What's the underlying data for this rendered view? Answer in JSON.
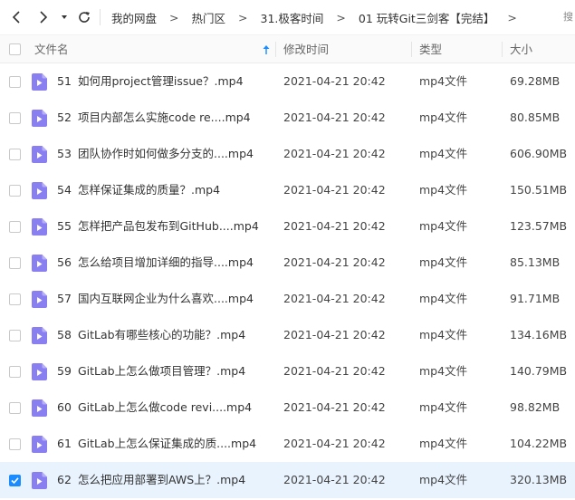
{
  "toolbar": {
    "back_icon": "chevron-left-icon",
    "forward_icon": "chevron-right-icon",
    "history_icon": "caret-down-icon",
    "refresh_icon": "refresh-icon"
  },
  "breadcrumb": {
    "items": [
      "我的网盘",
      "热门区",
      "31.极客时间",
      "01 玩转Git三剑客【完结】"
    ],
    "separator": ">",
    "trailing_chevron": ">"
  },
  "topright_text": "搜",
  "header": {
    "name": "文件名",
    "modified": "修改时间",
    "type": "类型",
    "size": "大小",
    "sort_icon": "sort-ascending-icon"
  },
  "colors": {
    "accent": "#1a8cff",
    "file_icon": "#8a7ff0",
    "selected_row": "#e8f3fe"
  },
  "files": [
    {
      "num": "51",
      "name": "如何用project管理issue？.mp4",
      "modified": "2021-04-21 20:42",
      "type": "mp4文件",
      "size": "69.28MB",
      "checked": false
    },
    {
      "num": "52",
      "name": "项目内部怎么实施code re....mp4",
      "modified": "2021-04-21 20:42",
      "type": "mp4文件",
      "size": "80.85MB",
      "checked": false
    },
    {
      "num": "53",
      "name": "团队协作时如何做多分支的....mp4",
      "modified": "2021-04-21 20:42",
      "type": "mp4文件",
      "size": "606.90MB",
      "checked": false
    },
    {
      "num": "54",
      "name": "怎样保证集成的质量？.mp4",
      "modified": "2021-04-21 20:42",
      "type": "mp4文件",
      "size": "150.51MB",
      "checked": false
    },
    {
      "num": "55",
      "name": "怎样把产品包发布到GitHub....mp4",
      "modified": "2021-04-21 20:42",
      "type": "mp4文件",
      "size": "123.57MB",
      "checked": false
    },
    {
      "num": "56",
      "name": "怎么给项目增加详细的指导....mp4",
      "modified": "2021-04-21 20:42",
      "type": "mp4文件",
      "size": "85.13MB",
      "checked": false
    },
    {
      "num": "57",
      "name": "国内互联网企业为什么喜欢....mp4",
      "modified": "2021-04-21 20:42",
      "type": "mp4文件",
      "size": "91.71MB",
      "checked": false
    },
    {
      "num": "58",
      "name": "GitLab有哪些核心的功能？.mp4",
      "modified": "2021-04-21 20:42",
      "type": "mp4文件",
      "size": "134.16MB",
      "checked": false
    },
    {
      "num": "59",
      "name": "GitLab上怎么做项目管理？.mp4",
      "modified": "2021-04-21 20:42",
      "type": "mp4文件",
      "size": "140.79MB",
      "checked": false
    },
    {
      "num": "60",
      "name": "GitLab上怎么做code revi....mp4",
      "modified": "2021-04-21 20:42",
      "type": "mp4文件",
      "size": "98.82MB",
      "checked": false
    },
    {
      "num": "61",
      "name": "GitLab上怎么保证集成的质....mp4",
      "modified": "2021-04-21 20:42",
      "type": "mp4文件",
      "size": "104.22MB",
      "checked": false
    },
    {
      "num": "62",
      "name": "怎么把应用部署到AWS上？.mp4",
      "modified": "2021-04-21 20:42",
      "type": "mp4文件",
      "size": "320.13MB",
      "checked": true
    }
  ]
}
